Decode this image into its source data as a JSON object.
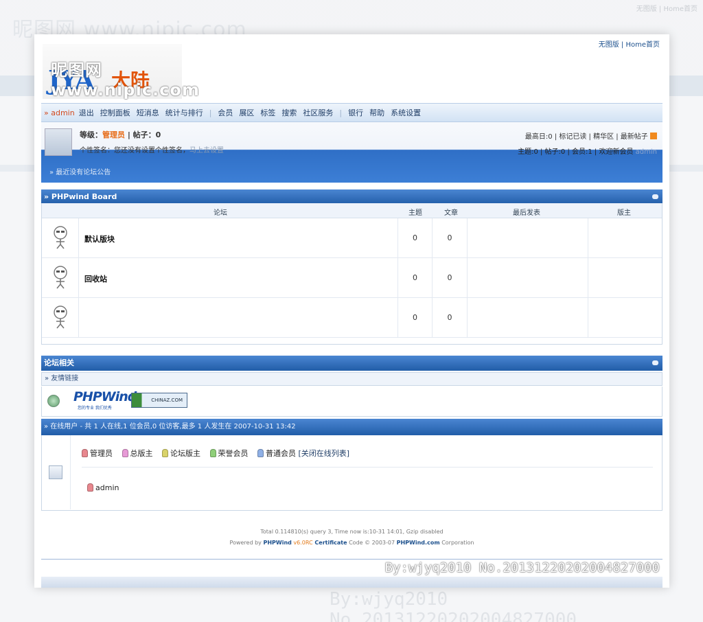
{
  "watermark": {
    "site": "昵图网 www.nipic.com",
    "stamp": "By:wjyq2010  No.20131220202004827000"
  },
  "top_links": {
    "text": "无图版 | Home首页"
  },
  "logo": {
    "letters": "JYA",
    "cn": "大陆"
  },
  "nav": {
    "user": "» admin",
    "items": [
      "退出",
      "控制面板",
      "短消息",
      "统计与排行",
      "会员",
      "展区",
      "标签",
      "搜索",
      "社区服务",
      "银行",
      "帮助",
      "系统设置"
    ]
  },
  "user_panel": {
    "grade_label": "等级：",
    "grade_value": "管理员",
    "posts_label": " | 帖子：0",
    "sign_label": "个性签名：您还没有设置个性签名，",
    "sign_link": "马上去设置",
    "right_line1": "最高日:0 | 标记已读 | 精华区 | 最新帖子",
    "right_line2_prefix": "主题:0 | 帖子:0 | 会员:1 | 欢迎新会员 ",
    "right_line2_user": "admin",
    "notice": "» 最近没有论坛公告"
  },
  "board": {
    "title": "» PHPwind Board",
    "headers": {
      "forum": "论坛",
      "topics": "主题",
      "posts": "文章",
      "last": "最后发表",
      "moderator": "版主"
    },
    "rows": [
      {
        "name": "默认版块",
        "topics": "0",
        "posts": "0"
      },
      {
        "name": "回收站",
        "topics": "0",
        "posts": "0"
      },
      {
        "name": "",
        "topics": "0",
        "posts": "0"
      }
    ]
  },
  "related": {
    "title": "论坛相关",
    "links_title": "» 友情链接",
    "phpwind": "PHPWind",
    "phpwind_sub": "您的专业 我们优秀",
    "chinaz": "CHINAZ.COM"
  },
  "online": {
    "header": "» 在线用户 - 共 1 人在线,1 位会员,0 位访客,最多 1 人发生在 2007-10-31 13:42",
    "legend": [
      {
        "label": "管理员",
        "color": "#e8878e"
      },
      {
        "label": "总版主",
        "color": "#e79ad6"
      },
      {
        "label": "论坛版主",
        "color": "#d9d36a"
      },
      {
        "label": "荣誉会员",
        "color": "#8fcf79"
      },
      {
        "label": "普通会员",
        "color": "#8fb0e6"
      }
    ],
    "close_link": "[关闭在线列表]",
    "user": "admin",
    "user_color": "#e8878e"
  },
  "footer": {
    "line1": "Total 0.114810(s) query 3, Time now is:10-31 14:01, Gzip disabled",
    "powered_prefix": "Powered by ",
    "powered_brand": "PHPWind",
    "version": " v6.0RC",
    "certificate": " Certificate",
    "code": " Code © 2003-07 ",
    "company": "PHPWind.com",
    "corp": " Corporation"
  }
}
